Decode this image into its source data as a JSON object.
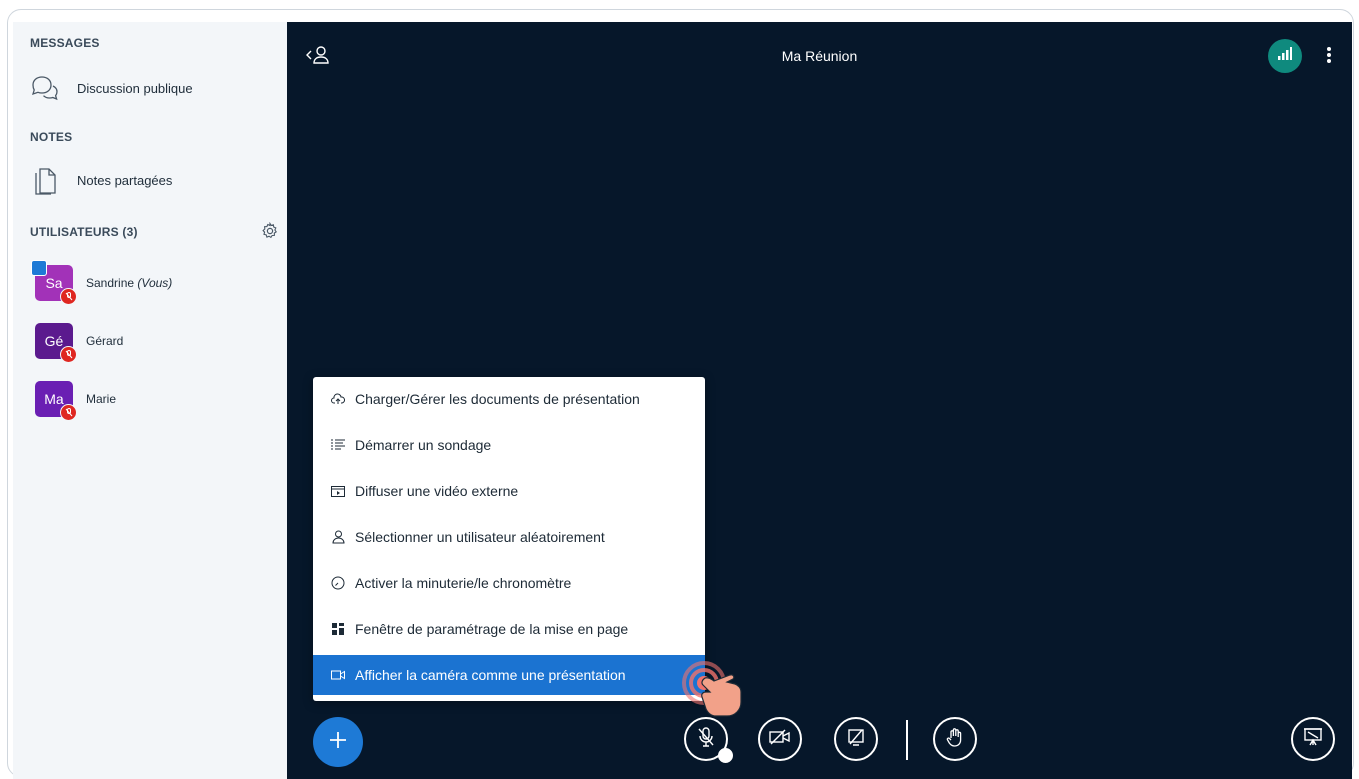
{
  "sidebar": {
    "messages_title": "MESSAGES",
    "public_chat_label": "Discussion publique",
    "notes_title": "NOTES",
    "shared_notes_label": "Notes partagées",
    "users_title": "UTILISATEURS (3)",
    "users": [
      {
        "initials": "Sa",
        "name": "Sandrine",
        "suffix": "(Vous)",
        "color": "#a232b8"
      },
      {
        "initials": "Gé",
        "name": "Gérard",
        "suffix": "",
        "color": "#5b1a8e"
      },
      {
        "initials": "Ma",
        "name": "Marie",
        "suffix": "",
        "color": "#6a1fb3"
      }
    ]
  },
  "header": {
    "meeting_title": "Ma Réunion"
  },
  "actions_menu": {
    "items": [
      {
        "label": "Charger/Gérer les documents de présentation",
        "icon": "upload-cloud-icon"
      },
      {
        "label": "Démarrer un sondage",
        "icon": "poll-icon"
      },
      {
        "label": "Diffuser une vidéo externe",
        "icon": "external-video-icon"
      },
      {
        "label": "Sélectionner un utilisateur aléatoirement",
        "icon": "random-user-icon"
      },
      {
        "label": "Activer la minuterie/le chronomètre",
        "icon": "timer-icon"
      },
      {
        "label": "Fenêtre de paramétrage de la mise en page",
        "icon": "layout-icon"
      },
      {
        "label": "Afficher la caméra comme une présentation",
        "icon": "camera-presentation-icon"
      }
    ],
    "highlighted_index": 6
  },
  "colors": {
    "main_bg": "#06172a",
    "accent_blue": "#1b73d1",
    "connection_green": "#0f8a7e",
    "mute_red": "#df2721"
  }
}
